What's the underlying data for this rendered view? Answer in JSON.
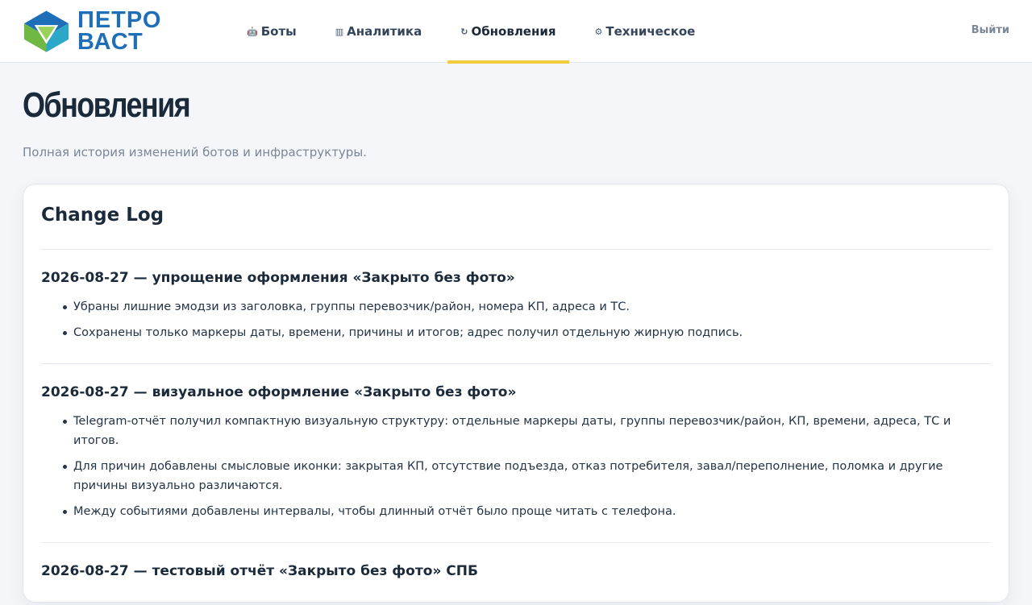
{
  "header": {
    "logo_line1": "ПЕТРО",
    "logo_line2": "ВАСТ",
    "nav": [
      {
        "icon": "robot-icon",
        "glyph": "🤖",
        "label": "Боты",
        "active": false
      },
      {
        "icon": "bar-chart-icon",
        "glyph": "▥",
        "label": "Аналитика",
        "active": false
      },
      {
        "icon": "refresh-icon",
        "glyph": "↻",
        "label": "Обновления",
        "active": true
      },
      {
        "icon": "gear-icon",
        "glyph": "⚙",
        "label": "Техническое",
        "active": false
      }
    ],
    "logout_label": "Выйти"
  },
  "page": {
    "title": "Обновления",
    "subtitle": "Полная история изменений ботов и инфраструктуры."
  },
  "changelog": {
    "title": "Change Log",
    "entries": [
      {
        "title": "2026-08-27 — упрощение оформления «Закрыто без фото»",
        "items": [
          "Убраны лишние эмодзи из заголовка, группы перевозчик/район, номера КП, адреса и ТС.",
          "Сохранены только маркеры даты, времени, причины и итогов; адрес получил отдельную жирную подпись."
        ]
      },
      {
        "title": "2026-08-27 — визуальное оформление «Закрыто без фото»",
        "items": [
          "Telegram-отчёт получил компактную визуальную структуру: отдельные маркеры даты, группы перевозчик/район, КП, времени, адреса, ТС и итогов.",
          "Для причин добавлены смысловые иконки: закрытая КП, отсутствие подъезда, отказ потребителя, завал/переполнение, поломка и другие причины визуально различаются.",
          "Между событиями добавлены интервалы, чтобы длинный отчёт было проще читать с телефона."
        ]
      },
      {
        "title": "2026-08-27 — тестовый отчёт «Закрыто без фото» СПБ",
        "items": []
      }
    ]
  },
  "colors": {
    "accent_underline": "#f2cc3d",
    "logo_blue": "#1f6fb8",
    "logo_green": "#8cc63f"
  }
}
